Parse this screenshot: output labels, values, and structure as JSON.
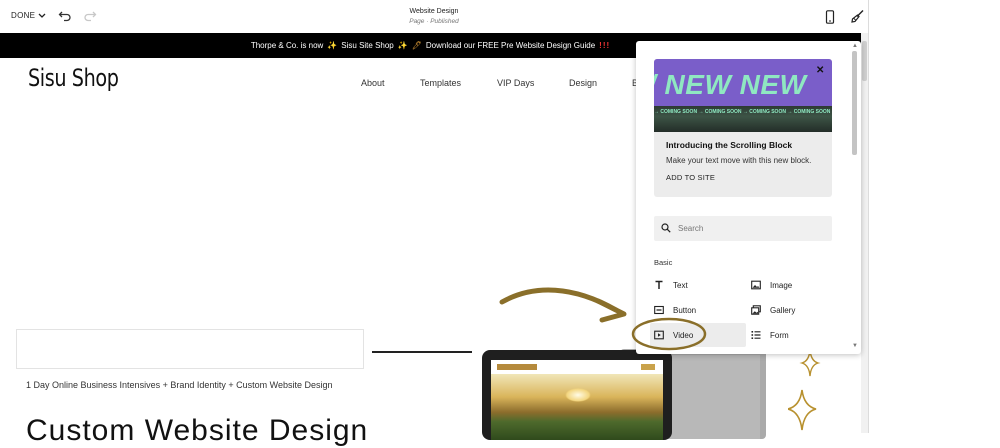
{
  "editor": {
    "done_label": "DONE",
    "page_title": "Website Design",
    "page_subtitle": "Page · Published",
    "icons": {
      "done_chevron": "chevron-down-icon",
      "undo": "undo-icon",
      "redo": "redo-icon",
      "mobile": "mobile-phone-icon",
      "style": "paint-brush-icon"
    }
  },
  "site": {
    "announcement": {
      "text_1": "Thorpe & Co. is now",
      "sparkle": "✨",
      "text_2": "Sisu Site Shop",
      "pen": "🖊",
      "text_3": "Download our FREE Pre Website Design Guide",
      "bangs": "!!!"
    },
    "logo": "Sisu Shop",
    "nav": [
      "About",
      "Templates",
      "VIP Days",
      "Design",
      "B"
    ],
    "tagline": "1 Day Online Business Intensives + Brand Identity + Custom Website Design",
    "headline": "Custom Website Design"
  },
  "panel": {
    "promo": {
      "banner_text": "/ NEW NEW",
      "ticker": "→ COMING SOON → COMING SOON → COMING SOON → COMING SOON → COMING SOON",
      "title": "Introducing the Scrolling Block",
      "description": "Make your text move with this new block.",
      "cta": "ADD TO SITE"
    },
    "search": {
      "value": "",
      "placeholder": "Search"
    },
    "section": "Basic",
    "blocks": [
      {
        "label": "Text",
        "icon": "text-icon"
      },
      {
        "label": "Image",
        "icon": "image-icon"
      },
      {
        "label": "Button",
        "icon": "button-icon"
      },
      {
        "label": "Gallery",
        "icon": "gallery-icon"
      },
      {
        "label": "Video",
        "icon": "video-icon",
        "highlighted": true
      },
      {
        "label": "Form",
        "icon": "form-list-icon"
      }
    ]
  },
  "colors": {
    "announcement_bg": "#000000",
    "annotation_gold": "#8a6f2a",
    "promo_banner": "#7a5ec9",
    "promo_text": "#8fe8c1"
  }
}
